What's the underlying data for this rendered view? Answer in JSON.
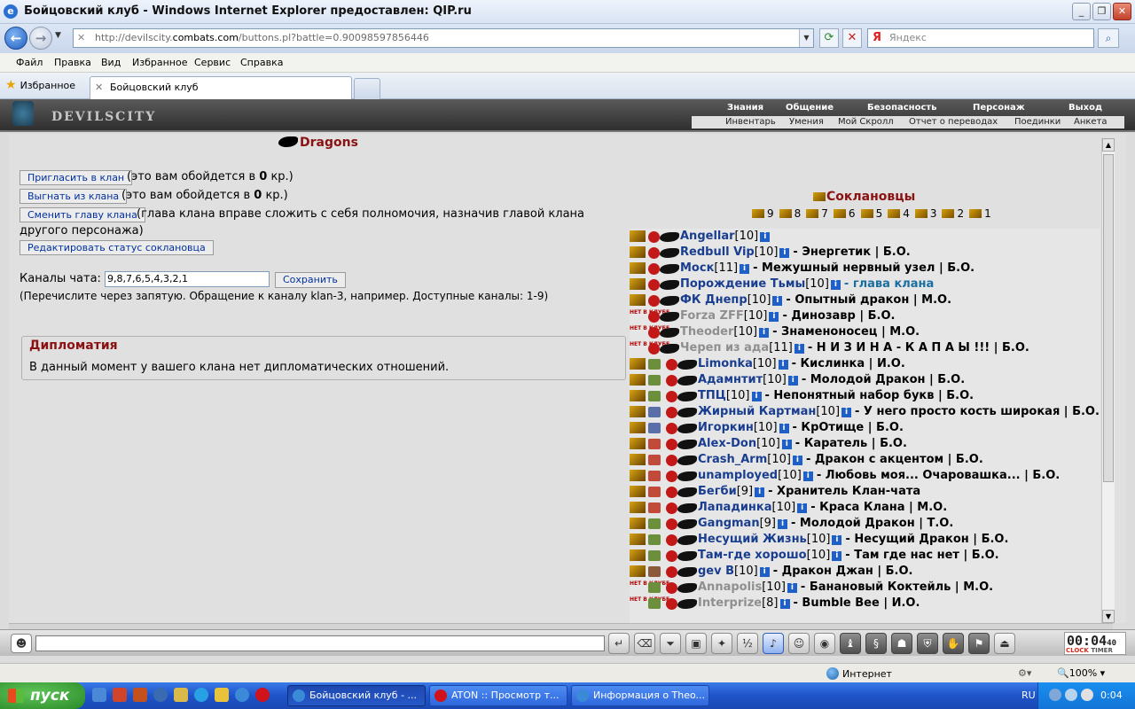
{
  "window": {
    "title": "Бойцовский клуб - Windows Internet Explorer предоставлен: QIP.ru"
  },
  "address": {
    "prefix": "http://devilscity.",
    "domain": "combats.com",
    "suffix": "/buttons.pl?battle=0.90098597856446"
  },
  "search": {
    "placeholder": "Яндекс"
  },
  "menu": [
    "Файл",
    "Правка",
    "Вид",
    "Избранное",
    "Сервис",
    "Справка"
  ],
  "favorites": {
    "label": "Избранное"
  },
  "tab": {
    "label": "Бойцовский клуб"
  },
  "game": {
    "logo": "DEVILSCITY",
    "menu_top": [
      "Знания",
      "Общение",
      "Безопасность",
      "Персонаж",
      "Выход"
    ],
    "menu_sub": [
      "Инвентарь",
      "Умения",
      "Мой Скролл",
      "Отчет о переводах",
      "Поединки",
      "Анкета"
    ]
  },
  "clan": {
    "name": "Dragons",
    "actions": [
      {
        "label": "Пригласить в клан",
        "note_pre": "(это вам обойдется в ",
        "amount": "0",
        "note_post": " кр.)"
      },
      {
        "label": "Выгнать из клана",
        "note_pre": "(это вам обойдется в ",
        "amount": "0",
        "note_post": " кр.)"
      },
      {
        "label": "Сменить главу клана",
        "note": "(глава клана вправе сложить с себя полномочия, назначив главой клана",
        "note2": "другого персонажа)"
      },
      {
        "label": "Редактировать статус соклановца"
      }
    ],
    "channels": {
      "label": "Каналы чата:",
      "value": "9,8,7,6,5,4,3,2,1",
      "save": "Сохранить",
      "hint": "(Перечислите через запятую. Обращение к каналу klan-3, например. Доступные каналы: 1-9)"
    },
    "diplomacy": {
      "title": "Дипломатия",
      "text": "В данный момент у вашего клана нет дипломатических отношений."
    }
  },
  "members_panel": {
    "title": "Соклановцы",
    "channels": [
      "9",
      "8",
      "7",
      "6",
      "5",
      "4",
      "3",
      "2",
      "1"
    ],
    "members": [
      {
        "name": "Angellar",
        "level": "[10]",
        "status": "",
        "online": true,
        "marker": "crown",
        "avatar": "none"
      },
      {
        "name": "Redbull Vip",
        "level": "[10]",
        "status": "Энергетик | Б.О.",
        "online": true,
        "marker": "crown",
        "avatar": "none"
      },
      {
        "name": "Моск",
        "level": "[11]",
        "status": "Межушный нервный узел | Б.О.",
        "online": true,
        "marker": "crown",
        "avatar": "none"
      },
      {
        "name": "Порождение Тьмы",
        "level": "[10]",
        "status": "глава клана",
        "teal": true,
        "online": true,
        "marker": "crown",
        "avatar": "none"
      },
      {
        "name": "ФК Днепр",
        "level": "[10]",
        "status": "Опытный дракон | М.О.",
        "online": true,
        "marker": "crown",
        "avatar": "none"
      },
      {
        "name": "Forza ZFF",
        "level": "[10]",
        "status": "Динозавр | Б.О.",
        "online": false,
        "marker": "notclub",
        "avatar": "none"
      },
      {
        "name": "Theoder",
        "level": "[10]",
        "status": "Знаменоносец | М.О.",
        "online": false,
        "marker": "notclub",
        "avatar": "none"
      },
      {
        "name": "Череп из ада",
        "level": "[11]",
        "status": "Н И З И Н А - К А П А Ы !!! | Б.О.",
        "online": false,
        "marker": "notclub",
        "avatar": "none"
      },
      {
        "name": "Limonka",
        "level": "[10]",
        "status": "Кислинка | И.О.",
        "online": true,
        "marker": "crown",
        "avatar": "green"
      },
      {
        "name": "Адамнтит",
        "level": "[10]",
        "status": "Молодой Дракон | Б.О.",
        "online": true,
        "marker": "crown",
        "avatar": "green"
      },
      {
        "name": "ТПЦ",
        "level": "[10]",
        "status": "Непонятный набор букв | Б.О.",
        "online": true,
        "marker": "crown",
        "avatar": "green"
      },
      {
        "name": "Жирный Картман",
        "level": "[10]",
        "status": "У него просто кость широкая | Б.О.",
        "online": true,
        "marker": "crown",
        "avatar": "blue"
      },
      {
        "name": "Игоркин",
        "level": "[10]",
        "status": "КрОтище | Б.О.",
        "online": true,
        "marker": "crown",
        "avatar": "blue"
      },
      {
        "name": "Alex-Don",
        "level": "[10]",
        "status": "Каратель | Б.О.",
        "online": true,
        "marker": "crown",
        "avatar": "red"
      },
      {
        "name": "Crash_Arm",
        "level": "[10]",
        "status": "Дракон с акцентом | Б.О.",
        "online": true,
        "marker": "crown",
        "avatar": "red"
      },
      {
        "name": "unamployed",
        "level": "[10]",
        "status": "Любовь моя... Очаровашка... | Б.О.",
        "online": true,
        "marker": "crown",
        "avatar": "red"
      },
      {
        "name": "Бегби",
        "level": "[9]",
        "status": "Хранитель Клан-чата",
        "online": true,
        "marker": "crown",
        "avatar": "red"
      },
      {
        "name": "Лападинка",
        "level": "[10]",
        "status": "Краса Клана | М.О.",
        "online": true,
        "marker": "crown",
        "avatar": "red"
      },
      {
        "name": "Gangman",
        "level": "[9]",
        "status": "Молодой Дракон | Т.О.",
        "online": true,
        "marker": "crown",
        "avatar": "green"
      },
      {
        "name": "Несущий Жизнь",
        "level": "[10]",
        "status": "Несущий Дракон | Б.О.",
        "online": true,
        "marker": "crown",
        "avatar": "green"
      },
      {
        "name": "Там-где хорошо",
        "level": "[10]",
        "status": "Там где нас нет | Б.О.",
        "online": true,
        "marker": "crown",
        "avatar": "green"
      },
      {
        "name": "gev B",
        "level": "[10]",
        "status": "Дракон Джан | Б.О.",
        "online": true,
        "marker": "crown",
        "avatar": "brown"
      },
      {
        "name": "Annapolis",
        "level": "[10]",
        "status": "Банановый Коктейль | М.О.",
        "online": false,
        "marker": "notclub",
        "avatar": "green"
      },
      {
        "name": "Interprize",
        "level": "[8]",
        "status": "Bumble Bee | И.О.",
        "online": false,
        "marker": "notclub",
        "avatar": "green"
      }
    ]
  },
  "not_in_club_label": "НЕТ В КЛУБЕ",
  "chat_clock": {
    "time": "00:04",
    "seconds": "40",
    "clock_label": "CLOCK",
    "timer_label": "TIMER"
  },
  "statusbar": {
    "zone": "Интернет",
    "zoom": "100%"
  },
  "taskbar": {
    "start": "пуск",
    "tasks": [
      "Бойцовский клуб - ...",
      "ATON :: Просмотр т...",
      "Информация о Theo..."
    ],
    "lang": "RU",
    "time": "0:04"
  },
  "colors": {
    "clan_red": "#8a1212",
    "member_blue": "#1a3e8f",
    "offline_gray": "#8f8f8f",
    "status_teal": "#1a6ea0"
  }
}
